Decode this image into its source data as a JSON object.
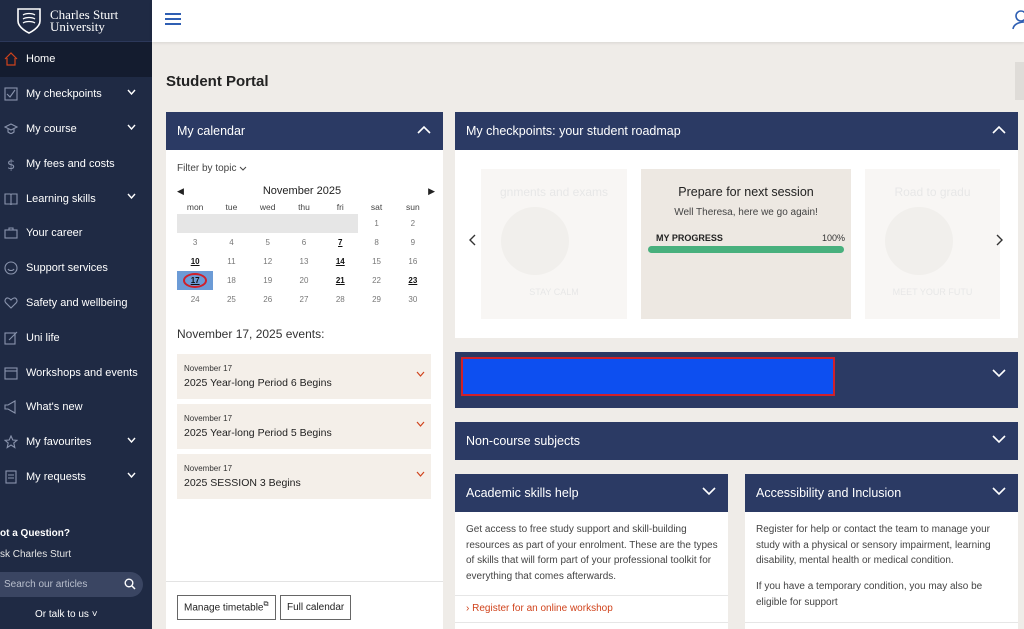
{
  "brand": {
    "line1": "Charles Sturt",
    "line2": "University"
  },
  "sidebar": {
    "items": [
      {
        "label": "Home",
        "icon": "home-icon",
        "active": true,
        "chevron": false
      },
      {
        "label": "My checkpoints",
        "icon": "checkbox-icon",
        "chevron": true
      },
      {
        "label": "My course",
        "icon": "graduation-cap-icon",
        "chevron": true
      },
      {
        "label": "My fees and costs",
        "icon": "dollar-icon",
        "chevron": false
      },
      {
        "label": "Learning skills",
        "icon": "book-icon",
        "chevron": true
      },
      {
        "label": "Your career",
        "icon": "briefcase-icon",
        "chevron": false
      },
      {
        "label": "Support services",
        "icon": "smile-icon",
        "chevron": false
      },
      {
        "label": "Safety and wellbeing",
        "icon": "heart-icon",
        "chevron": false
      },
      {
        "label": "Uni life",
        "icon": "pencil-icon",
        "chevron": false
      },
      {
        "label": "Workshops and events",
        "icon": "calendar-icon",
        "chevron": false
      },
      {
        "label": "What's new",
        "icon": "megaphone-icon",
        "chevron": false
      },
      {
        "label": "My favourites",
        "icon": "star-icon",
        "chevron": true
      },
      {
        "label": "My requests",
        "icon": "list-icon",
        "chevron": true
      }
    ],
    "question": "ot a Question?",
    "ask": "sk Charles Sturt",
    "search_placeholder": "Search our articles",
    "talk": "Or talk to us"
  },
  "page": {
    "title": "Student Portal"
  },
  "calendar": {
    "title": "My calendar",
    "filter": "Filter by topic",
    "month": "November 2025",
    "weekdays": [
      "mon",
      "tue",
      "wed",
      "thu",
      "fri",
      "sat",
      "sun"
    ],
    "weeks": [
      [
        "",
        "",
        "",
        "",
        "",
        "1",
        "2"
      ],
      [
        "3",
        "4",
        "5",
        "6",
        "7",
        "8",
        "9"
      ],
      [
        "10",
        "11",
        "12",
        "13",
        "14",
        "15",
        "16"
      ],
      [
        "17",
        "18",
        "19",
        "20",
        "21",
        "22",
        "23"
      ],
      [
        "24",
        "25",
        "26",
        "27",
        "28",
        "29",
        "30"
      ]
    ],
    "event_days": [
      "7",
      "10",
      "14",
      "17",
      "21",
      "23"
    ],
    "selected_day": "17",
    "events_title": "November 17, 2025 events:",
    "events": [
      {
        "date": "November 17",
        "title": "2025 Year-long Period 6 Begins"
      },
      {
        "date": "November 17",
        "title": "2025 Year-long Period 5 Begins"
      },
      {
        "date": "November 17",
        "title": "2025 SESSION 3 Begins"
      }
    ],
    "manage_btn": "Manage timetable",
    "full_btn": "Full calendar"
  },
  "checkpoints": {
    "title": "My checkpoints: your student roadmap",
    "left_title": "gnments and exams",
    "left_bottom": "STAY CALM",
    "mid_title": "Prepare for next session",
    "mid_sub": "Well Theresa, here we go again!",
    "progress_label": "MY PROGRESS",
    "progress_value": "100%",
    "progress_fraction": 1.0,
    "right_title": "Road to gradu",
    "right_bottom": "MEET YOUR FUTU"
  },
  "noncourse": {
    "title": "Non-course subjects"
  },
  "academic": {
    "title": "Academic skills help",
    "body": "Get access to free study support and skill-building resources as part of your enrolment. These are the types of skills that will form part of your professional toolkit for everything that comes afterwards.",
    "link": "Register for an online workshop"
  },
  "access": {
    "title": "Accessibility and Inclusion",
    "body1": "Register for help or contact the team to manage your study with a physical or sensory impairment, learning disability, mental health or medical condition.",
    "body2": "If you have a temporary condition, you may also be eligible for support"
  },
  "colors": {
    "sidebar": "#1f2a44",
    "header": "#2b3a64",
    "accent": "#d0431c",
    "progress": "#48b07d",
    "redact": "#0d4ff0"
  }
}
